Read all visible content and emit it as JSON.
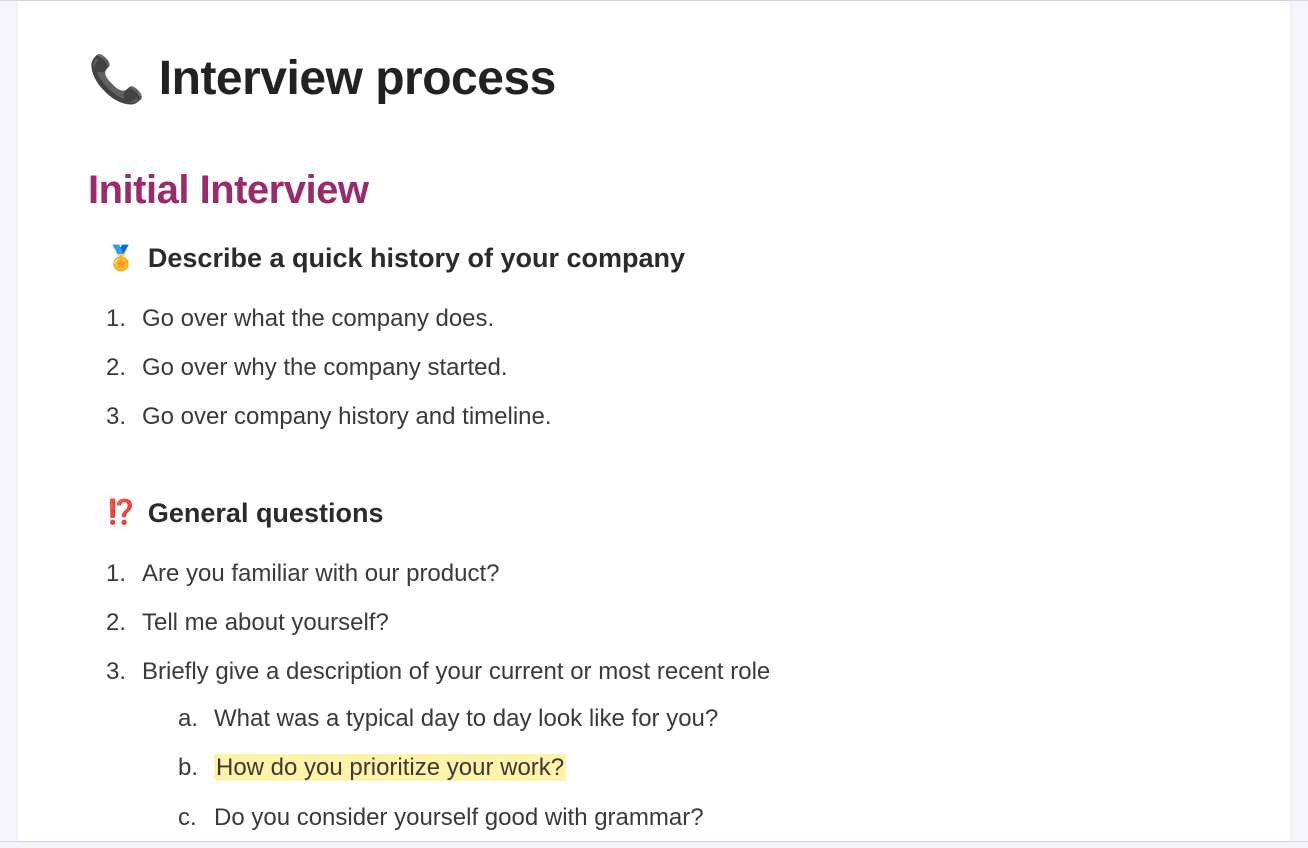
{
  "title_emoji": "📞",
  "title_text": "Interview process",
  "section_heading": "Initial Interview",
  "sub1": {
    "emoji": "🏅",
    "heading": "Describe a quick history of your company",
    "items": [
      "Go over what the company does.",
      "Go over why the company started.",
      "Go over company history and timeline."
    ]
  },
  "sub2": {
    "emoji": "⁉️",
    "heading": "General questions",
    "items": [
      "Are you familiar with our product?",
      "Tell me about yourself?",
      "Briefly give a description of your current or most recent role"
    ],
    "subitems": [
      "What was a typical day to day look like for you?",
      "How do you prioritize your work?",
      "Do you consider yourself good with grammar?"
    ],
    "highlight_index": 1
  }
}
